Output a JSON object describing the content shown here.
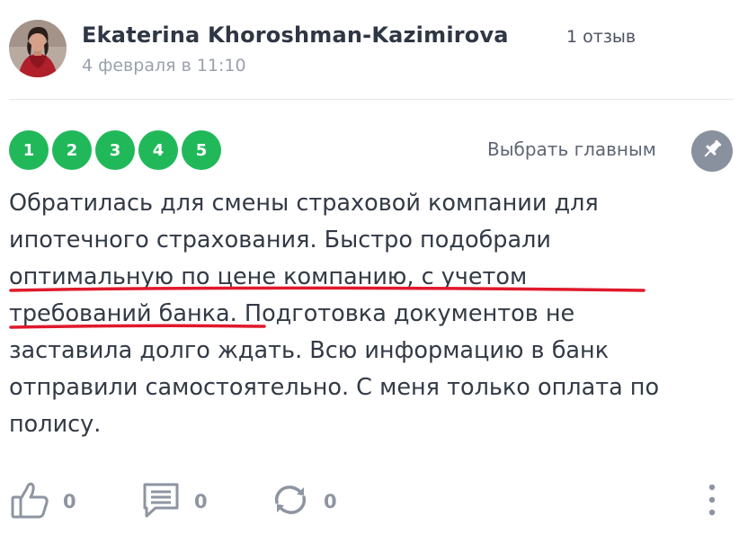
{
  "author": {
    "name": "Ekaterina Khoroshman-Kazimirova",
    "reviews": "1 отзыв",
    "date": "4 февраля в 11:10"
  },
  "rating": {
    "value": 5,
    "color": "#21b85a",
    "items": [
      "1",
      "2",
      "3",
      "4",
      "5"
    ]
  },
  "pin": {
    "label": "Выбрать главным",
    "icon": "pin-icon"
  },
  "review": {
    "lines": [
      "Обратилась для смены страховой компании для",
      "ипотечного страхования. Быстро подобрали",
      "оптимальную по цене компанию, с учетом",
      "требований банка. Подготовка документов не",
      "заставила долго ждать. Всю информацию в банк",
      "отправили самостоятельно. С меня только оплата по",
      "полису."
    ],
    "highlight_color": "#e0192c"
  },
  "actions": {
    "likes": "0",
    "comments": "0",
    "reposts": "0"
  }
}
